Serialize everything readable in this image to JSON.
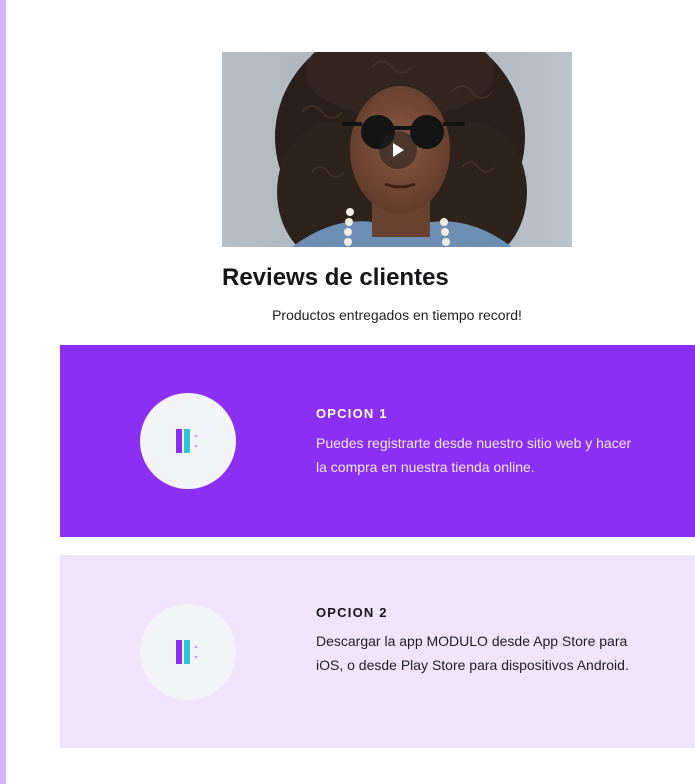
{
  "heading": "Reviews de clientes",
  "subheading": "Productos entregados en tiempo record!",
  "video": {
    "play_icon": "play-icon",
    "thumbnail": "portrait of a man with curly hair and sunglasses"
  },
  "options": [
    {
      "title": "OPCION 1",
      "description": "Puedes registrarte desde nuestro sitio web y hacer la compra en nuestra tienda online.",
      "icon": "module-logo-icon",
      "background": "#8b2ff2",
      "title_color": "#ffffff",
      "text_color": "#f1e6ff"
    },
    {
      "title": "OPCION 2",
      "description": "Descargar la app MODULO desde App Store para iOS, o desde Play Store para dispositivos Android.",
      "icon": "module-logo-icon",
      "background": "#f0e4fd",
      "title_color": "#15151a",
      "text_color": "#1f1f1f"
    }
  ],
  "colors": {
    "accent_purple": "#8b2ff2",
    "accent_light": "#f0e4fd",
    "accent_teal": "#2ec5cf",
    "rail": "#d8b4fe"
  }
}
